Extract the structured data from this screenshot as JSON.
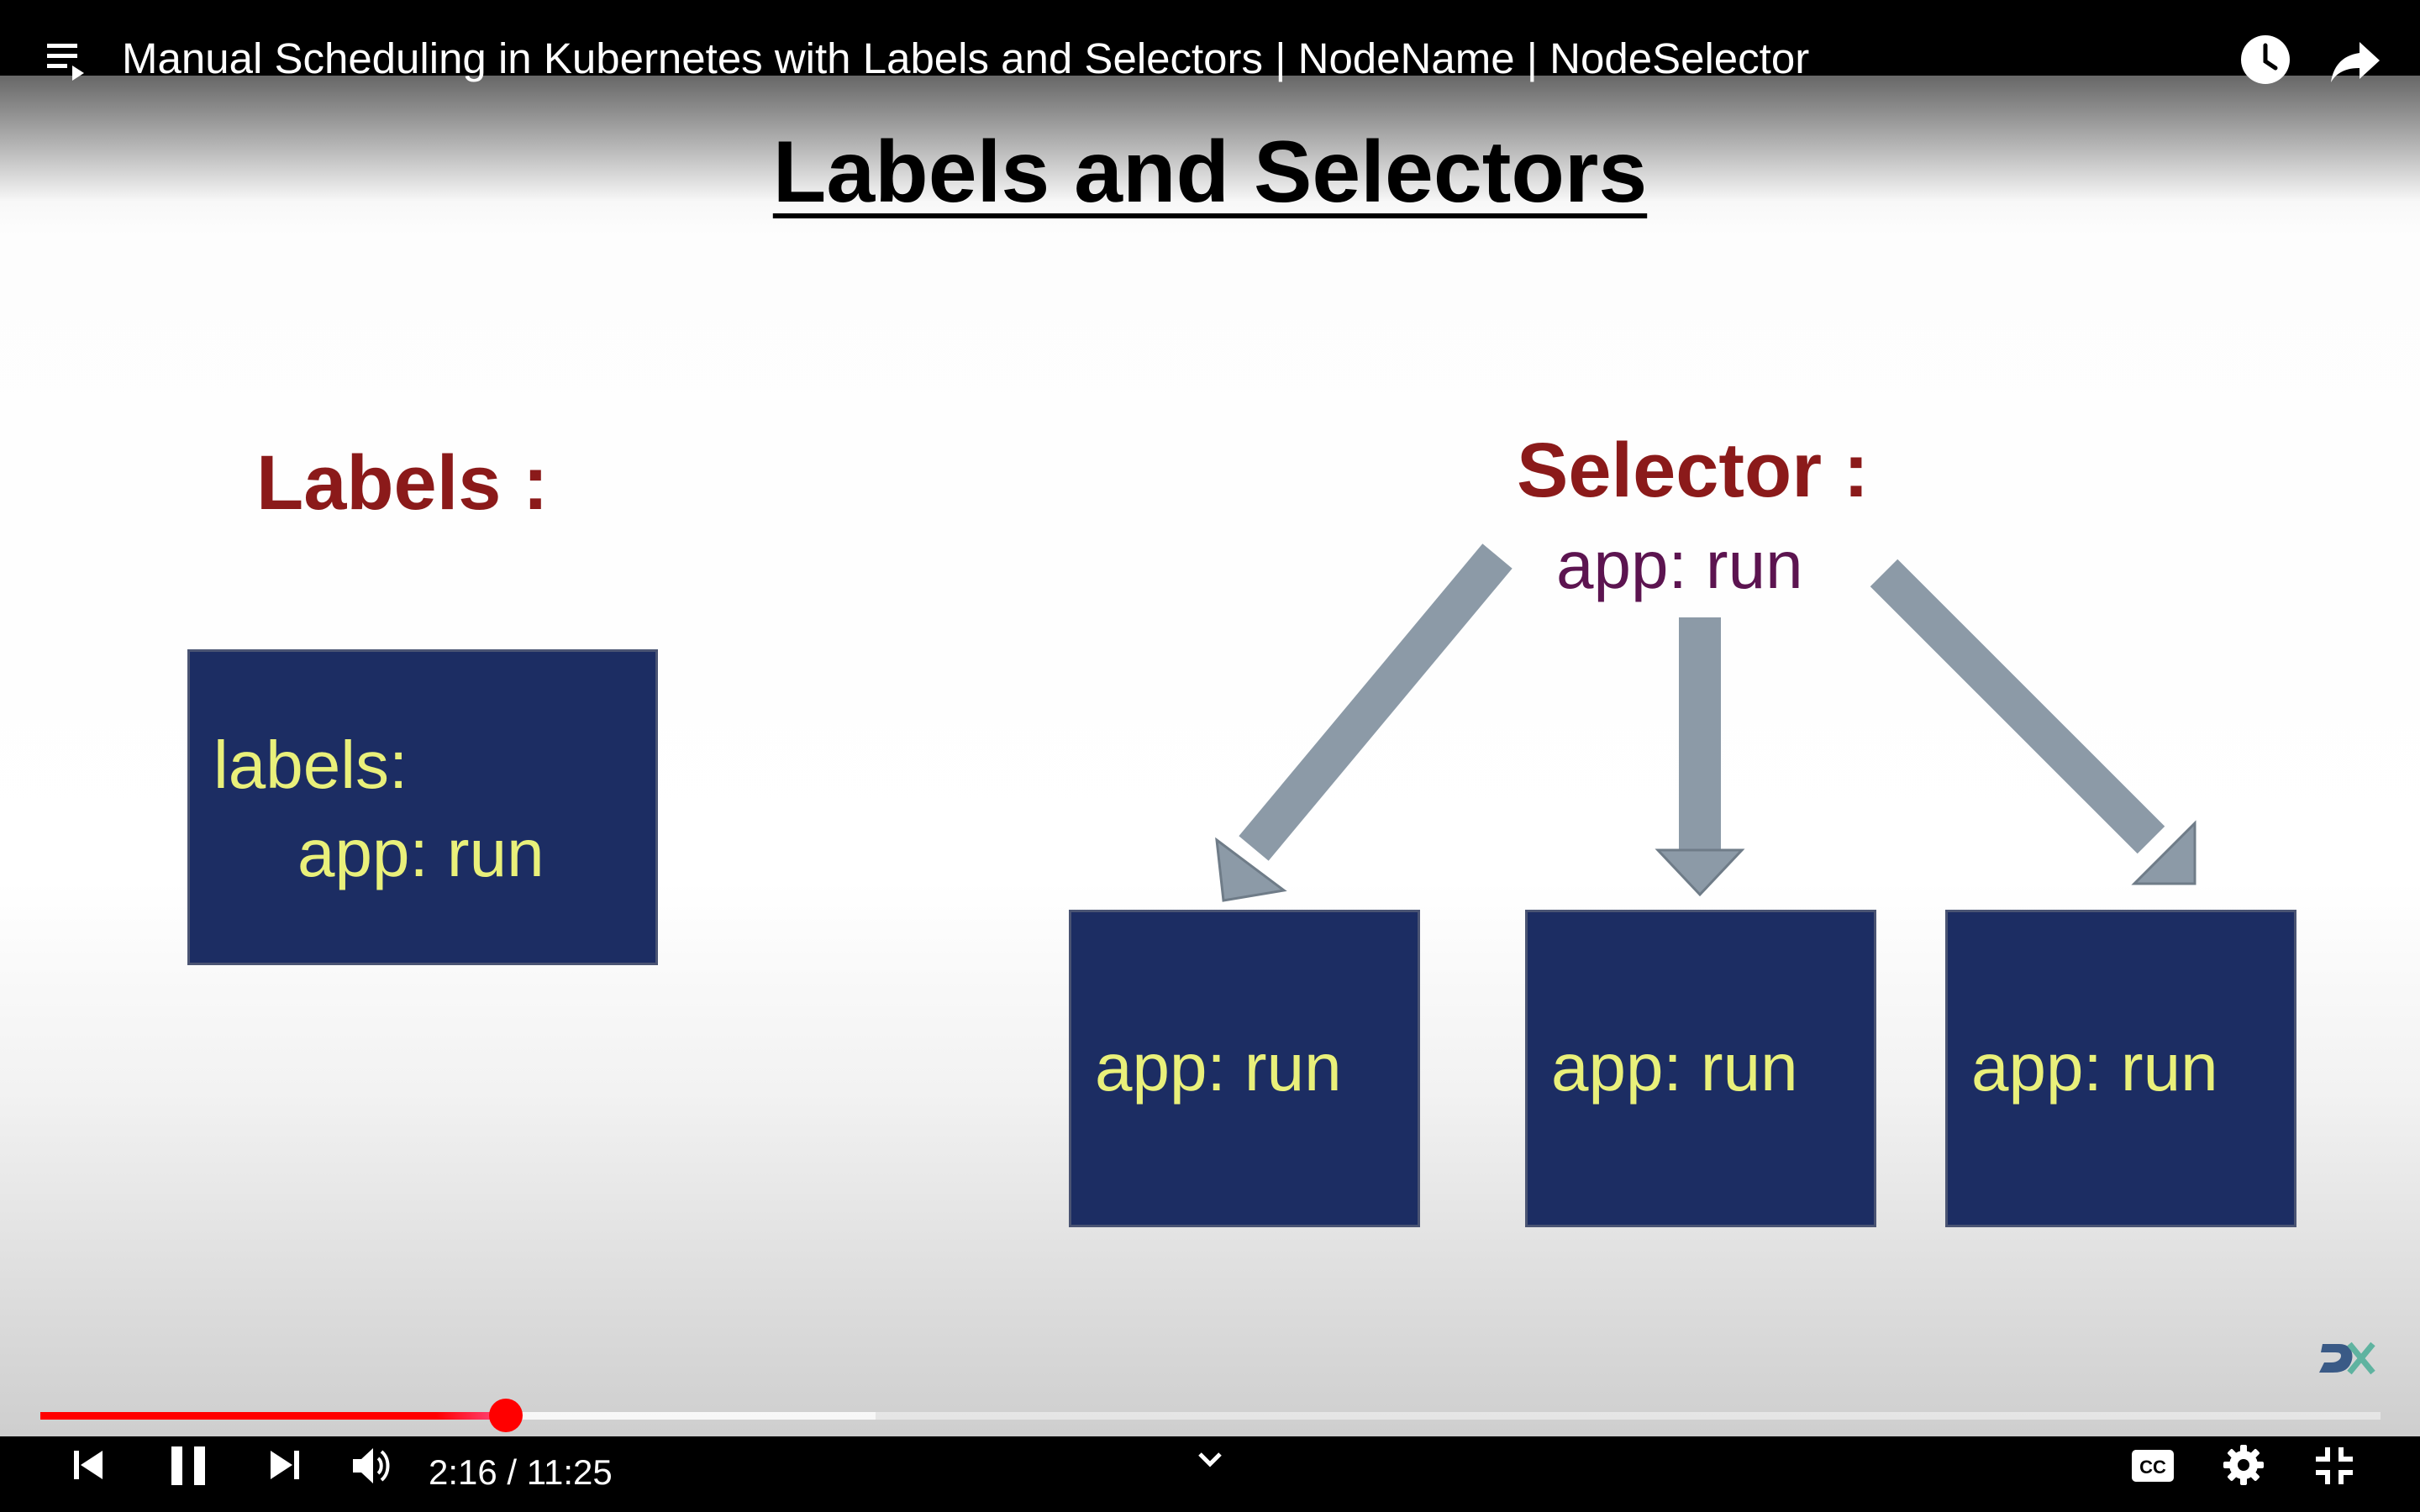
{
  "header": {
    "video_title": "Manual Scheduling in Kubernetes with Labels and Selectors | NodeName | NodeSelector",
    "playlist_icon": "playlist-icon",
    "watch_later_icon": "clock-icon",
    "share_icon": "share-arrow-icon"
  },
  "slide": {
    "title": "Labels and Selectors",
    "labels_heading": "Labels :",
    "label_box": {
      "line1": "labels:",
      "line2": "app: run"
    },
    "selector_heading": "Selector :",
    "selector_value": "app: run",
    "pods": [
      "app: run",
      "app: run",
      "app: run"
    ],
    "colors": {
      "heading": "#8b1a1a",
      "selector_value": "#5c1450",
      "box_fill": "#1c2d63",
      "box_text": "#e9f07a",
      "arrow": "#8c9aa7"
    }
  },
  "player": {
    "time_current": "2:16",
    "time_total": "11:25",
    "time_display": "2:16 / 11:25",
    "progress_fraction": 0.199,
    "buffered_fraction": 0.357,
    "accent_color": "#ff0000",
    "icons": [
      "previous-icon",
      "pause-icon",
      "next-icon",
      "volume-icon",
      "chevron-down-icon",
      "captions-icon",
      "gear-icon",
      "exit-fullscreen-icon"
    ]
  }
}
